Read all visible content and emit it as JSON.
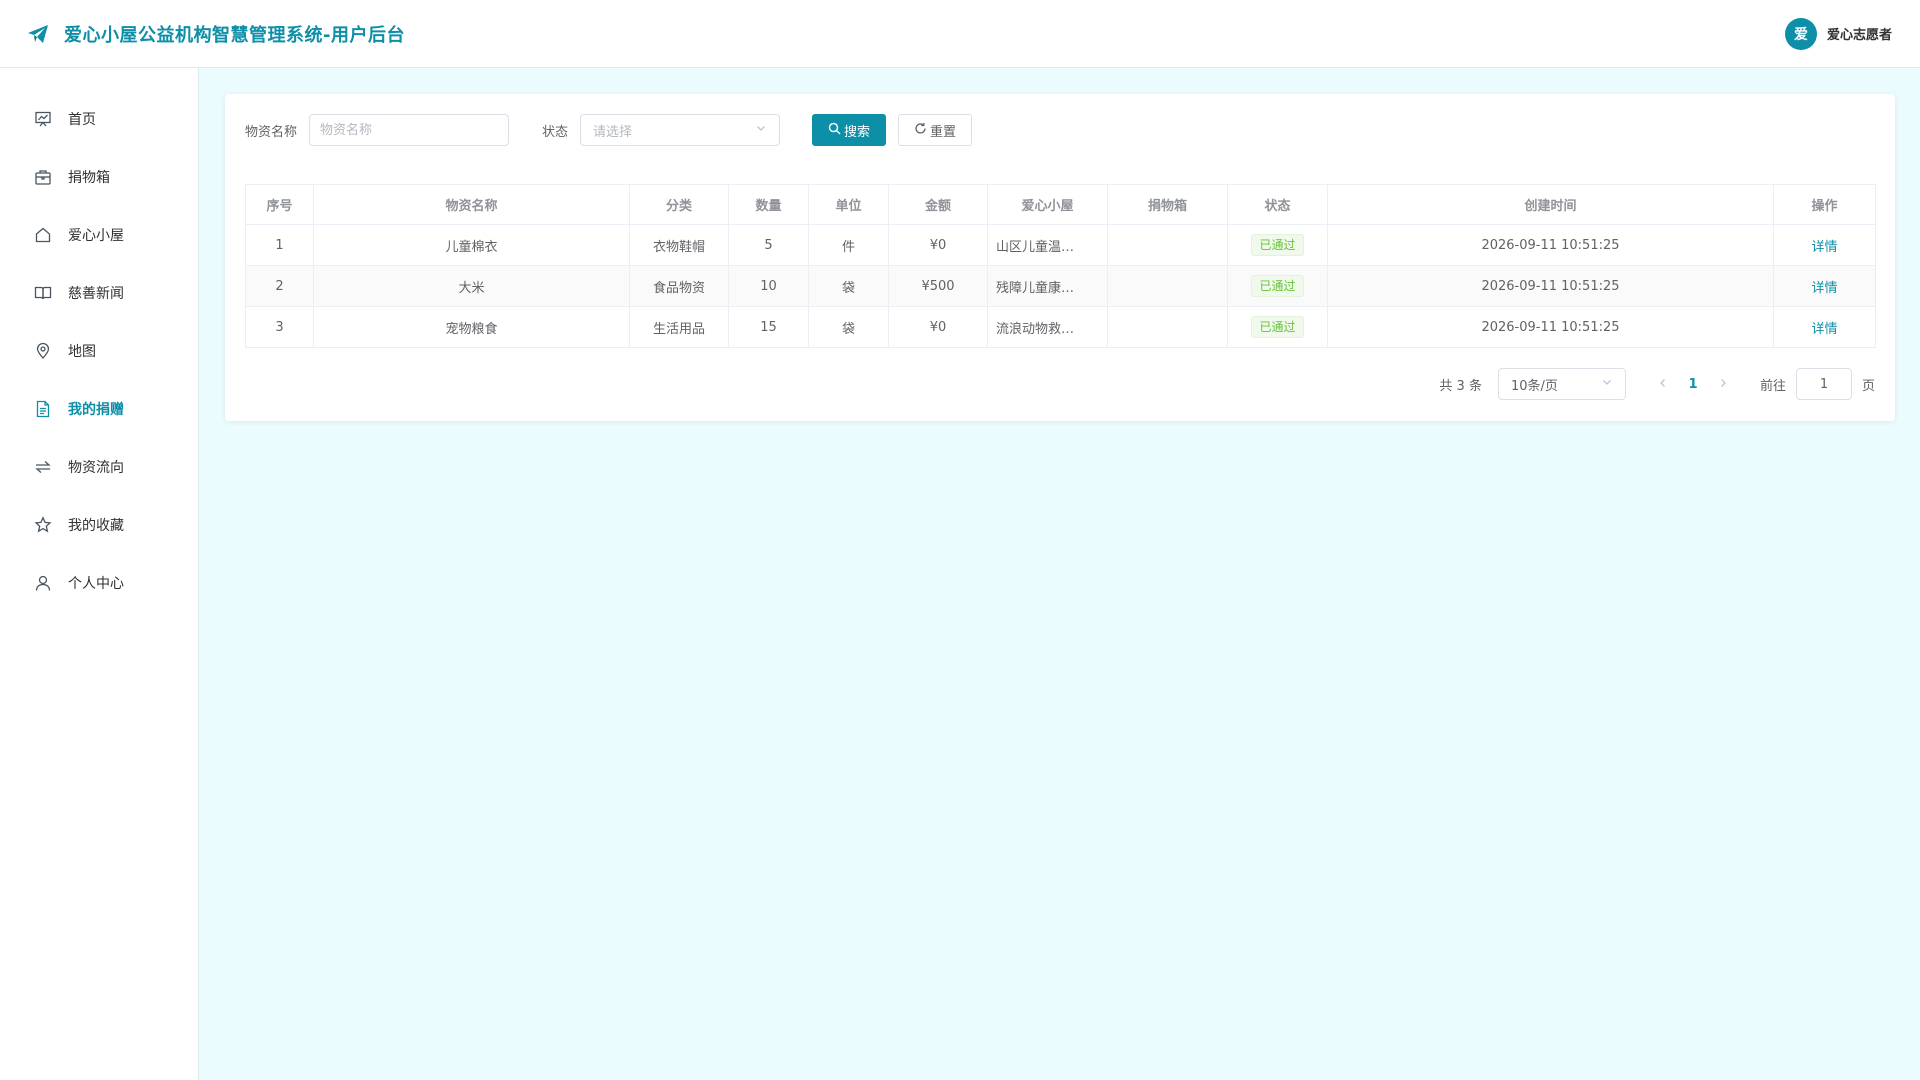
{
  "header": {
    "title": "爱心小屋公益机构智慧管理系统-用户后台",
    "avatar_text": "爱",
    "user_name": "爱心志愿者"
  },
  "colors": {
    "primary": "#0e8fa8",
    "success": "#67c23a",
    "background": "#ebfcfe"
  },
  "sidebar": {
    "items": [
      {
        "label": "首页",
        "icon": "dashboard-icon"
      },
      {
        "label": "捐物箱",
        "icon": "box-icon"
      },
      {
        "label": "爱心小屋",
        "icon": "house-icon"
      },
      {
        "label": "慈善新闻",
        "icon": "book-icon"
      },
      {
        "label": "地图",
        "icon": "location-pin-icon"
      },
      {
        "label": "我的捐赠",
        "icon": "document-icon",
        "active": true
      },
      {
        "label": "物资流向",
        "icon": "flow-arrows-icon"
      },
      {
        "label": "我的收藏",
        "icon": "star-icon"
      },
      {
        "label": "个人中心",
        "icon": "user-icon"
      }
    ]
  },
  "filters": {
    "name_label": "物资名称",
    "name_placeholder": "物资名称",
    "status_label": "状态",
    "status_placeholder": "请选择",
    "search_label": "搜索",
    "reset_label": "重置"
  },
  "table": {
    "headers": [
      "序号",
      "物资名称",
      "分类",
      "数量",
      "单位",
      "金额",
      "爱心小屋",
      "捐物箱",
      "状态",
      "创建时间",
      "操作"
    ],
    "rows": [
      {
        "index": "1",
        "name": "儿童棉衣",
        "category": "衣物鞋帽",
        "quantity": "5",
        "unit": "件",
        "amount": "¥0",
        "house": "山区儿童温…",
        "box": "",
        "status": "已通过",
        "created": "2026-09-11 10:51:25",
        "action": "详情"
      },
      {
        "index": "2",
        "name": "大米",
        "category": "食品物资",
        "quantity": "10",
        "unit": "袋",
        "amount": "¥500",
        "house": "残障儿童康…",
        "box": "",
        "status": "已通过",
        "created": "2026-09-11 10:51:25",
        "action": "详情"
      },
      {
        "index": "3",
        "name": "宠物粮食",
        "category": "生活用品",
        "quantity": "15",
        "unit": "袋",
        "amount": "¥0",
        "house": "流浪动物救…",
        "box": "",
        "status": "已通过",
        "created": "2026-09-11 10:51:25",
        "action": "详情"
      }
    ]
  },
  "pagination": {
    "total_text": "共 3 条",
    "page_size": "10条/页",
    "current_page": "1",
    "goto_label": "前往",
    "goto_value": "1",
    "page_suffix": "页"
  }
}
